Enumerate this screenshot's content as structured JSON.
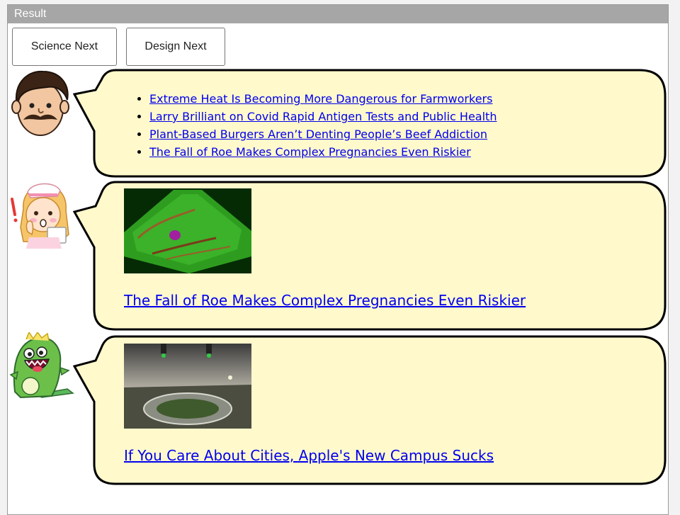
{
  "window": {
    "title": "Result"
  },
  "buttons": {
    "science": "Science Next",
    "design": "Design Next"
  },
  "bubbles": {
    "first": {
      "links": [
        "Extreme Heat Is Becoming More Dangerous for Farmworkers",
        "Larry Brilliant on Covid Rapid Antigen Tests and Public Health",
        "Plant-Based Burgers Aren’t Denting People’s Beef Addiction",
        "The Fall of Roe Makes Complex Pregnancies Even Riskier"
      ]
    },
    "second": {
      "headline": "The Fall of Roe Makes Complex Pregnancies Even Riskier"
    },
    "third": {
      "headline": "If You Care About Cities, Apple's New Campus Sucks"
    }
  },
  "colors": {
    "bubble_fill": "#fff9cc",
    "link": "#0000ee",
    "titlebar": "#a6a6a6"
  },
  "icons": {
    "avatar1": "mustache-man-avatar-icon",
    "avatar2": "nurse-avatar-icon",
    "avatar3": "green-monster-avatar-icon"
  }
}
